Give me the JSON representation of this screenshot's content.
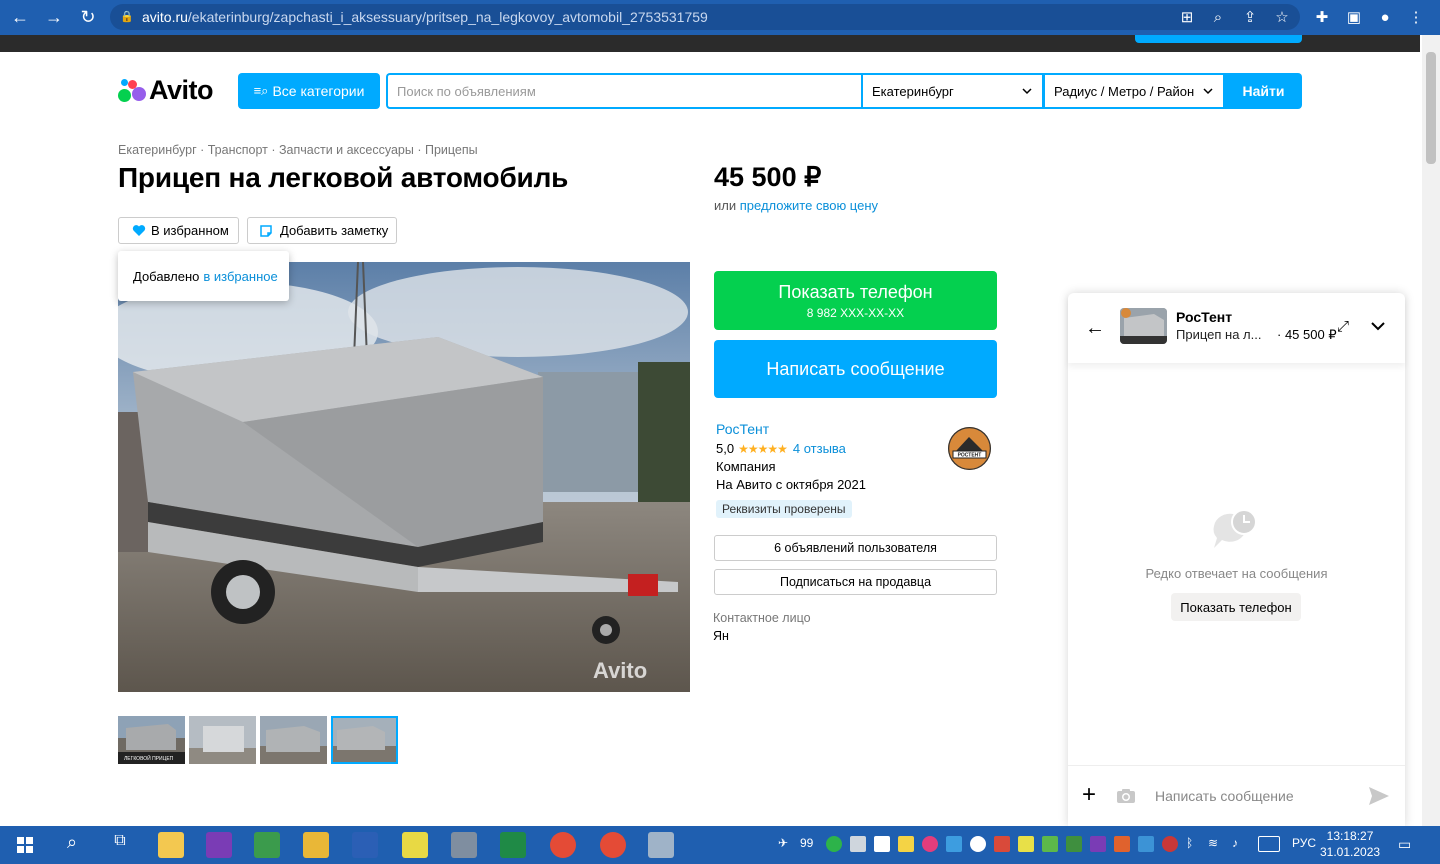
{
  "browser": {
    "url_host": "avito.ru",
    "url_path": "/ekaterinburg/zapchasti_i_aksessuary/pritsep_na_legkovoy_avtomobil_2753531759"
  },
  "header": {
    "logo": "Avito",
    "all_categories": "Все категории",
    "search_placeholder": "Поиск по объявлениям",
    "city": "Екатеринбург",
    "radius": "Радиус / Метро / Район",
    "find": "Найти"
  },
  "breadcrumbs": [
    "Екатеринбург",
    "Транспорт",
    "Запчасти и аксессуары",
    "Прицепы"
  ],
  "listing": {
    "title": "Прицеп на легковой автомобиль",
    "favorite": "В избранном",
    "add_note": "Добавить заметку",
    "tooltip_text": "Добавлено",
    "tooltip_link": "в избранное",
    "price": "45 500 ₽",
    "offer_prefix": "или",
    "offer_link": "предложите свою цену",
    "photo_watermark": "Avito",
    "thumb_caption": "ЛЕГКОВОЙ ПРИЦЕП"
  },
  "actions": {
    "show_phone": "Показать телефон",
    "phone_masked": "8 982 XXX-XX-XX",
    "write_message": "Написать сообщение"
  },
  "seller": {
    "name": "РосТент",
    "rating": "5,0",
    "stars": "★★★★★",
    "reviews": "4 отзыва",
    "type": "Компания",
    "since": "На Авито с октября 2021",
    "verified": "Реквизиты проверены",
    "ads_count": "6 объявлений пользователя",
    "subscribe": "Подписаться на продавца",
    "contact_label": "Контактное лицо",
    "contact_name": "Ян",
    "logo_text": "РОСТЕНТ"
  },
  "chat": {
    "seller_name": "РосТент",
    "item_short": "Прицеп на л...",
    "price": "45 500 ₽",
    "status": "Редко отвечает на сообщения",
    "show_phone": "Показать телефон",
    "input_placeholder": "Написать сообщение"
  },
  "taskbar": {
    "lang": "РУС",
    "time": "13:18:27",
    "date": "31.01.2023",
    "badge": "99"
  },
  "colors": {
    "accent": "#00aaff",
    "green": "#04d04f",
    "link": "#0a8fd9",
    "chrome": "#1f5fb0"
  }
}
